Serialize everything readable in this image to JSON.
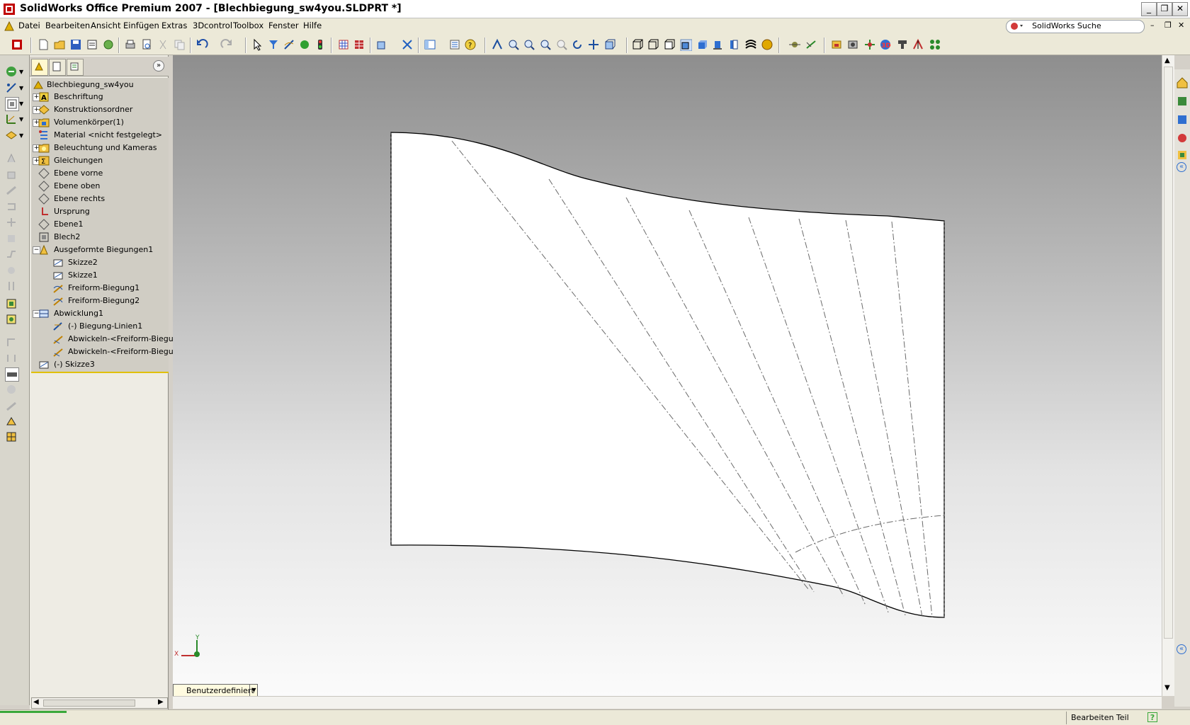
{
  "window": {
    "title": "SolidWorks Office Premium 2007 - [Blechbiegung_sw4you.SLDPRT *]",
    "buttons": [
      "_",
      "❐",
      "✕"
    ]
  },
  "menu": {
    "items": [
      "Datei",
      "Bearbeiten",
      "Ansicht",
      "Einfügen",
      "Extras",
      "3Dcontrol",
      "Toolbox",
      "Fenster",
      "Hilfe"
    ],
    "search_label": "SolidWorks Suche"
  },
  "tree": {
    "root": "Blechbiegung_sw4you",
    "nodes": [
      {
        "label": "Beschriftung",
        "expander": "+"
      },
      {
        "label": "Konstruktionsordner",
        "expander": "+"
      },
      {
        "label": "Volumenkörper(1)",
        "expander": "+"
      },
      {
        "label": "Material <nicht festgelegt>",
        "expander": ""
      },
      {
        "label": "Beleuchtung und Kameras",
        "expander": "+"
      },
      {
        "label": "Gleichungen",
        "expander": "+"
      },
      {
        "label": "Ebene vorne",
        "expander": ""
      },
      {
        "label": "Ebene oben",
        "expander": ""
      },
      {
        "label": "Ebene rechts",
        "expander": ""
      },
      {
        "label": "Ursprung",
        "expander": ""
      },
      {
        "label": "Ebene1",
        "expander": ""
      },
      {
        "label": "Blech2",
        "expander": ""
      },
      {
        "label": "Ausgeformte Biegungen1",
        "expander": "−"
      },
      {
        "label": "Skizze2",
        "expander": ""
      },
      {
        "label": "Skizze1",
        "expander": ""
      },
      {
        "label": "Freiform-Biegung1",
        "expander": ""
      },
      {
        "label": "Freiform-Biegung2",
        "expander": ""
      },
      {
        "label": "Abwicklung1",
        "expander": "−"
      },
      {
        "label": "(-) Biegung-Linien1",
        "expander": ""
      },
      {
        "label": "Abwickeln-<Freiform-Biegu",
        "expander": ""
      },
      {
        "label": "Abwickeln-<Freiform-Biegu",
        "expander": ""
      },
      {
        "label": "(-) Skizze3",
        "expander": ""
      }
    ]
  },
  "viewport": {
    "view_selector": "Benutzerdefiniert",
    "axis_x": "X",
    "axis_y": "Y"
  },
  "status": {
    "text": "Bearbeiten Teil",
    "help": "?"
  },
  "colors": {
    "accent": "#0a246a",
    "rollback": "#e0c000"
  }
}
